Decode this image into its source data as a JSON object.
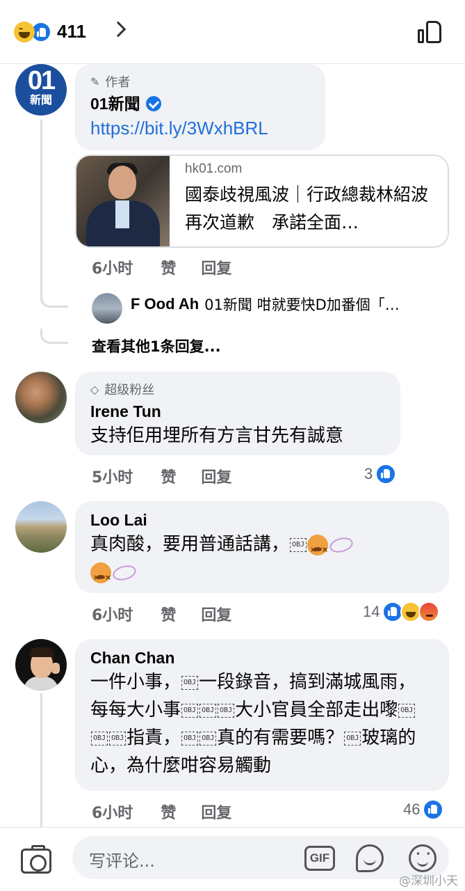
{
  "top_bar": {
    "reaction_count": "411"
  },
  "comments": [
    {
      "id": "01news",
      "badge": "作者",
      "name": "01新聞",
      "verified": true,
      "link": "https://bit.ly/3WxhBRL",
      "preview": {
        "domain": "hk01.com",
        "title": "國泰歧視風波｜行政總裁林紹波再次道歉　承諾全面…"
      },
      "time": "6小时",
      "like_label": "赞",
      "reply_label": "回复",
      "reply_preview": {
        "name": "F Ood Ah",
        "text": "01新聞 咁就要快D加番個「…"
      },
      "more_replies": "查看其他1条回复..."
    },
    {
      "id": "irene",
      "badge": "超级粉丝",
      "name": "Irene Tun",
      "text": "支持佢用埋所有方言甘先有誠意",
      "time": "5小时",
      "like_label": "赞",
      "reply_label": "回复",
      "reactions": "3"
    },
    {
      "id": "loo",
      "name": "Loo Lai",
      "text": "真肉酸，要用普通話講，",
      "time": "6小时",
      "like_label": "赞",
      "reply_label": "回复",
      "reactions": "14"
    },
    {
      "id": "chan",
      "name": "Chan Chan",
      "text_parts": [
        "一件小事，",
        "一段錄音，搞到滿城風雨，每每大小事",
        "大小官員全部走出嚟",
        "指責，",
        "真的有需要嗎？",
        "玻璃的心，為什麼咁容易觸動"
      ],
      "time": "6小时",
      "like_label": "赞",
      "reply_label": "回复",
      "reactions": "46"
    }
  ],
  "obj_glyph": "OBJ",
  "composer": {
    "placeholder": "写评论...",
    "gif_label": "GIF"
  },
  "watermark": "@深圳小天",
  "icons": [
    "haha-icon",
    "like-icon",
    "chevron-right-icon",
    "thumbs-up-outline-icon",
    "pencil-icon",
    "diamond-icon",
    "verified-icon",
    "dizzy-face-icon",
    "angry-icon",
    "camera-icon",
    "gif-icon",
    "sticker-icon",
    "smiley-icon"
  ],
  "colors": {
    "accent": "#1b74e4",
    "link": "#216fdb",
    "bubble": "#f0f2f5",
    "secondary_text": "#65676b"
  }
}
